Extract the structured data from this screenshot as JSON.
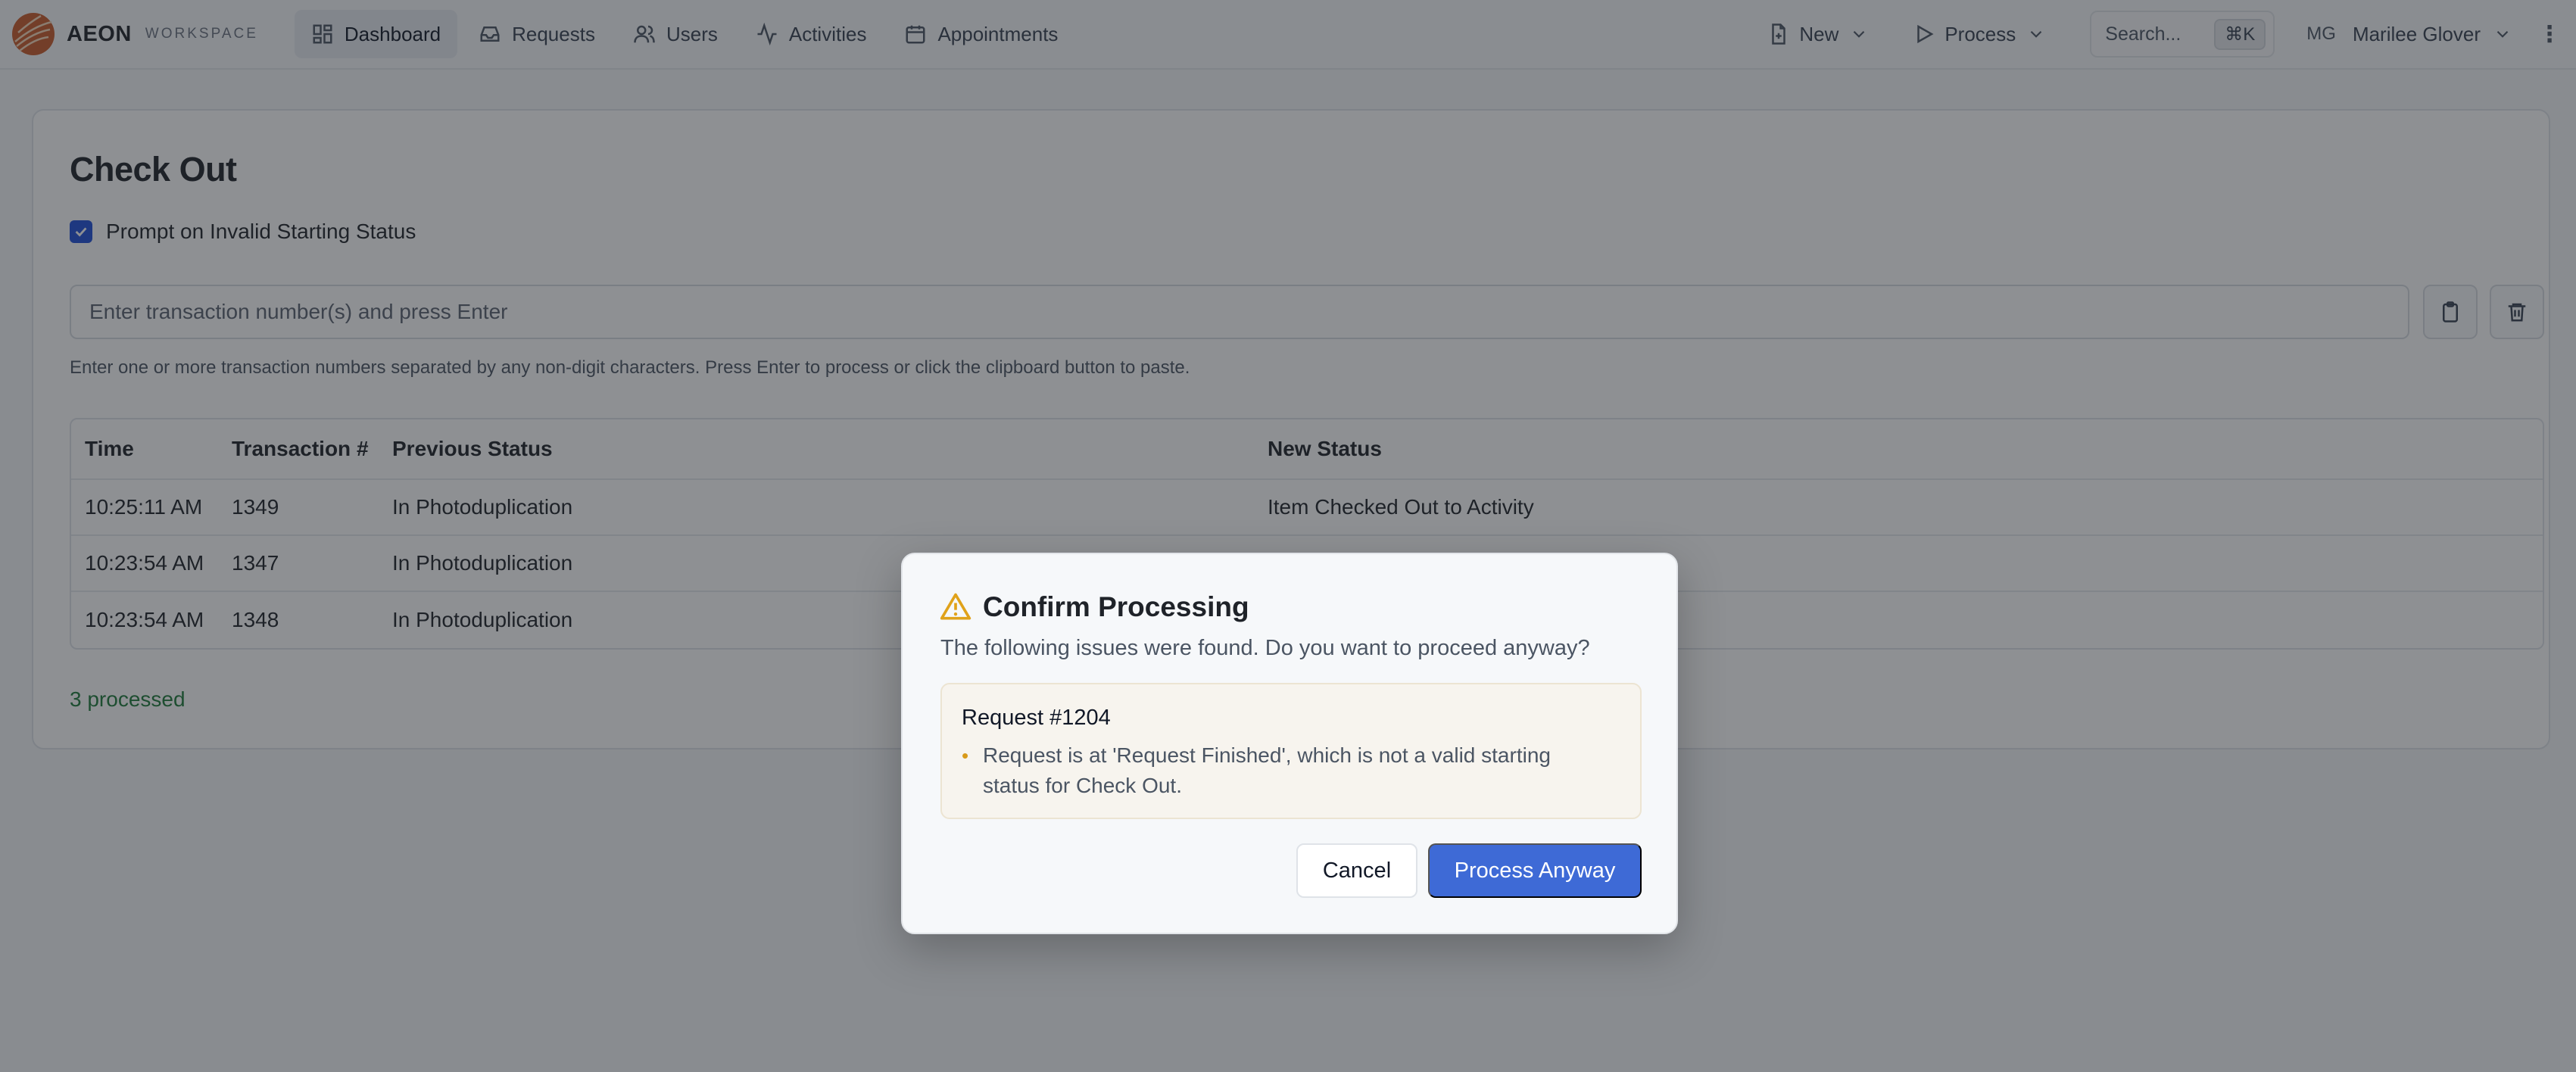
{
  "brand": {
    "name": "AEON",
    "sub": "WORKSPACE"
  },
  "nav": {
    "items": [
      {
        "label": "Dashboard",
        "icon": "dashboard-icon",
        "active": true
      },
      {
        "label": "Requests",
        "icon": "inbox-icon"
      },
      {
        "label": "Users",
        "icon": "users-icon"
      },
      {
        "label": "Activities",
        "icon": "activity-icon"
      },
      {
        "label": "Appointments",
        "icon": "calendar-icon"
      }
    ]
  },
  "topright": {
    "new_label": "New",
    "process_label": "Process",
    "search_label": "Search...",
    "search_kbd": "⌘K",
    "user_initials": "MG",
    "user_name": "Marilee Glover"
  },
  "page": {
    "title": "Check Out",
    "checkbox_label": "Prompt on Invalid Starting Status",
    "checkbox_checked": true,
    "input_placeholder": "Enter transaction number(s) and press Enter",
    "helper_text": "Enter one or more transaction numbers separated by any non-digit characters. Press Enter to process or click the clipboard button to paste.",
    "processed_text": "3 processed"
  },
  "table": {
    "headers": [
      "Time",
      "Transaction #",
      "Previous Status",
      "New Status"
    ],
    "rows": [
      [
        "10:25:11 AM",
        "1349",
        "In Photoduplication",
        "Item Checked Out to Activity"
      ],
      [
        "10:23:54 AM",
        "1347",
        "In Photoduplication",
        ""
      ],
      [
        "10:23:54 AM",
        "1348",
        "In Photoduplication",
        ""
      ]
    ]
  },
  "modal": {
    "title": "Confirm Processing",
    "description": "The following issues were found. Do you want to proceed anyway?",
    "issue_title": "Request #1204",
    "issue_text": "Request is at 'Request Finished', which is not a valid starting status for Check Out.",
    "cancel_label": "Cancel",
    "process_label": "Process Anyway"
  },
  "colors": {
    "accent": "#3e6ad6",
    "checkbox": "#1e4fd8",
    "success": "#1f7a3a",
    "warning": "#e0a21a"
  }
}
